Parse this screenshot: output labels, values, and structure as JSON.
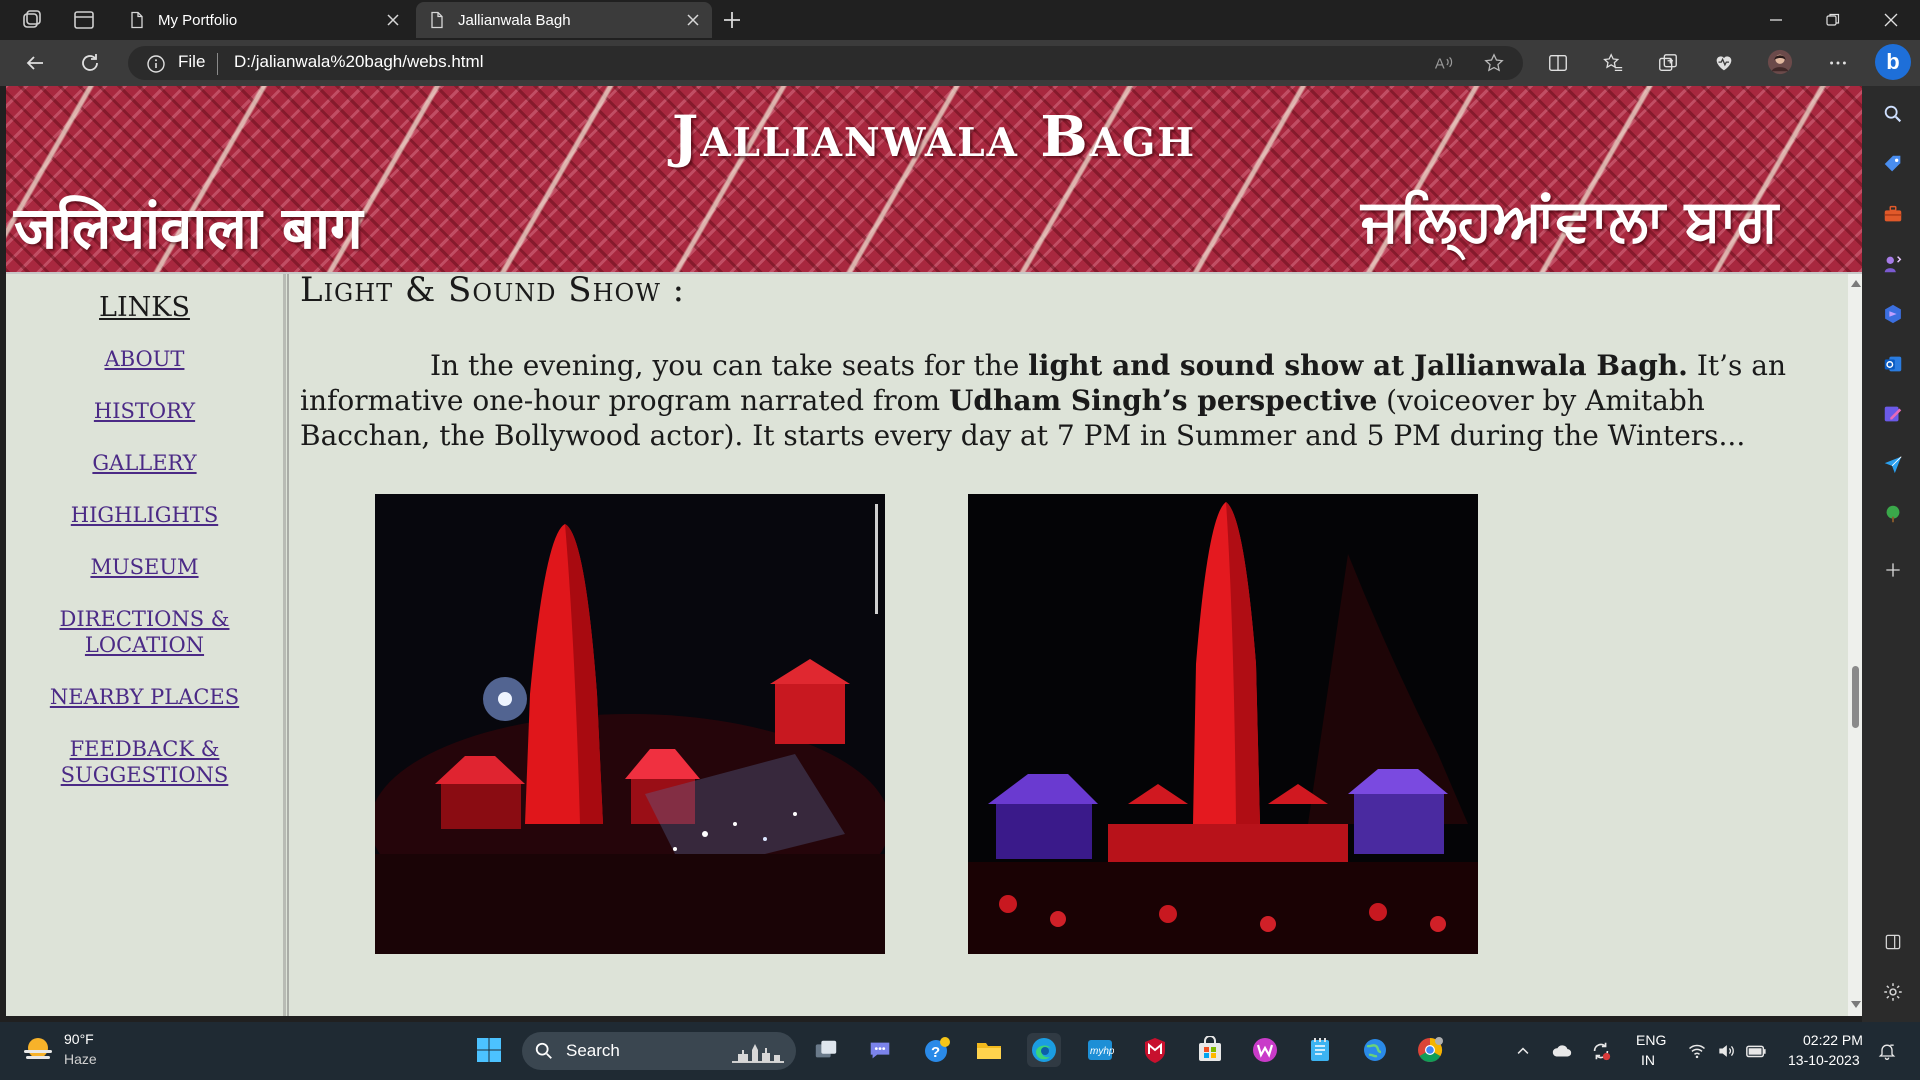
{
  "browser": {
    "tabs": [
      {
        "title": "My Portfolio",
        "active": false
      },
      {
        "title": "Jallianwala Bagh",
        "active": true
      }
    ],
    "address": {
      "scheme_label": "File",
      "url": "D:/jalianwala%20bagh/webs.html"
    }
  },
  "page": {
    "banner": {
      "title": "Jallianwala Bagh",
      "hindi": "जलियांवाला बाग",
      "punjabi": "ਜਲ੍ਹਿਆਂਵਾਲਾ ਬਾਗ"
    },
    "nav": {
      "heading": "LINKS",
      "links": [
        "ABOUT",
        "HISTORY",
        "GALLERY",
        "HIGHLIGHTS",
        "MUSEUM",
        "DIRECTIONS &",
        "LOCATION",
        "NEARBY PLACES",
        "FEEDBACK &",
        "SUGGESTIONS"
      ]
    },
    "section_title": "Light & Sound Show :",
    "paragraph": {
      "p1": "In the evening, you can take seats for the ",
      "b1": "light and sound show at Jallianwala Bagh.",
      "p2": " It’s an informative one-hour program narrated from ",
      "b2": "Udham Singh’s perspective",
      "p3": " (voiceover by Amitabh Bacchan, the Bollywood actor). It starts every day at 7 PM in Summer and 5 PM during the Winters..."
    },
    "scroll_fraction": 0.58
  },
  "taskbar": {
    "weather": {
      "temp": "90°F",
      "desc": "Haze"
    },
    "search_label": "Search",
    "lang": {
      "line1": "ENG",
      "line2": "IN"
    },
    "clock": {
      "time": "02:22 PM",
      "date": "13-10-2023"
    }
  },
  "colors": {
    "banner_red": "#a8283f",
    "page_bg": "#dde3d8",
    "link_color": "#4b2a86",
    "edge_accent": "#1e6fd9"
  }
}
